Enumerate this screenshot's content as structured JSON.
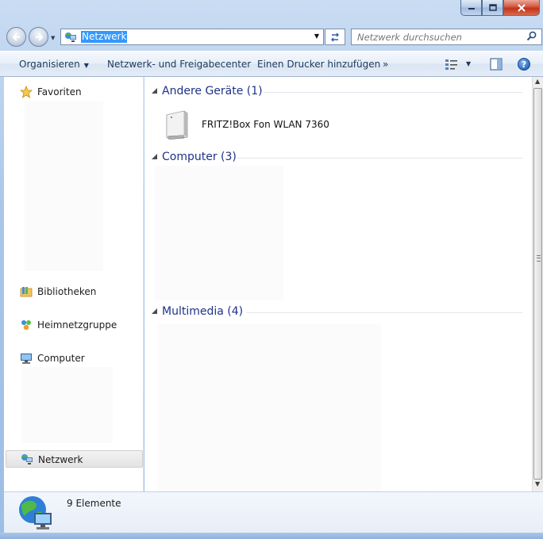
{
  "window": {
    "caption_buttons": [
      "minimize",
      "maximize",
      "close"
    ]
  },
  "navigation": {
    "address": {
      "value": "Netzwerk"
    },
    "search": {
      "placeholder": "Netzwerk durchsuchen"
    }
  },
  "toolbar": {
    "organize_label": "Organisieren",
    "network_center_label": "Netzwerk- und Freigabecenter",
    "add_printer_label": "Einen Drucker hinzufügen",
    "more_label": "»"
  },
  "sidebar": {
    "items": [
      {
        "label": "Favoriten",
        "icon": "star-icon"
      },
      {
        "label": "Bibliotheken",
        "icon": "library-icon"
      },
      {
        "label": "Heimnetzgruppe",
        "icon": "homegroup-icon"
      },
      {
        "label": "Computer",
        "icon": "computer-icon"
      },
      {
        "label": "Netzwerk",
        "icon": "network-icon",
        "selected": true
      }
    ]
  },
  "groups": [
    {
      "title": "Andere Geräte (1)",
      "items": [
        {
          "label": "FRITZ!Box Fon WLAN 7360",
          "icon": "device-icon"
        }
      ]
    },
    {
      "title": "Computer (3)",
      "items": []
    },
    {
      "title": "Multimedia (4)",
      "items": []
    }
  ],
  "status": {
    "count_text": "9 Elemente"
  },
  "colors": {
    "group_title": "#1e3287",
    "selection": "#3399ff",
    "toolbar_text": "#1e395b",
    "window_frame": "#a9c6ea"
  }
}
